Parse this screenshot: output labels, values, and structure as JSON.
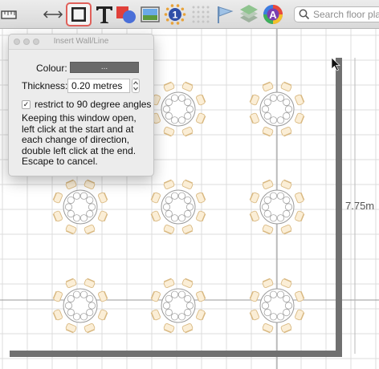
{
  "toolbar": {
    "tools": [
      {
        "name": "ruler-tool-icon"
      },
      {
        "name": "measure-arrow-icon"
      },
      {
        "name": "wall-tool-icon",
        "active": true
      },
      {
        "name": "text-tool-icon"
      },
      {
        "name": "shape-tool-icon"
      },
      {
        "name": "image-tool-icon"
      },
      {
        "name": "table-number-icon",
        "label": "1"
      },
      {
        "name": "grid-dots-icon"
      },
      {
        "name": "flag-icon"
      },
      {
        "name": "layers-icon"
      },
      {
        "name": "colour-wheel-icon",
        "label": "A"
      }
    ],
    "search": {
      "placeholder": "Search floor plan"
    }
  },
  "dialog": {
    "title": "Insert Wall/Line",
    "colour_label": "Colour:",
    "colour_button": "...",
    "thickness_label": "Thickness:",
    "thickness_value": "0.20 metres",
    "restrict_checked": true,
    "restrict_label": "restrict to 90 degree angles",
    "checkmark": "✓",
    "instructions": [
      "Keeping this window open,",
      "left click at the start and at",
      "each change of direction,",
      "double left click at the end.",
      "Escape to cancel."
    ]
  },
  "canvas": {
    "dimension_label": "7.75m",
    "colors": {
      "chair_fill": "#fbeed6",
      "chair_stroke": "#d9b982",
      "table_fill": "#ffffff",
      "table_stroke": "#9a9a9a",
      "wall": "#707070",
      "grid": "#dcdcdc",
      "axis": "#999999"
    }
  }
}
